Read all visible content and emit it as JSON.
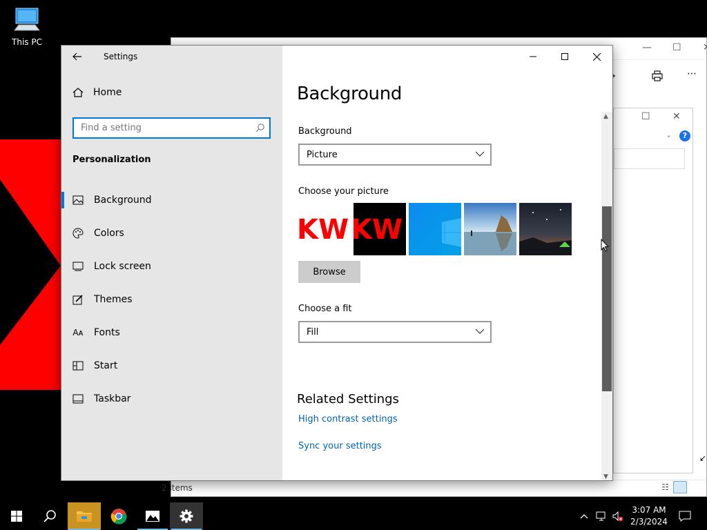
{
  "desktop": {
    "icon_label": "This PC"
  },
  "explorer": {
    "status_text": "2 items"
  },
  "settings": {
    "window_title": "Settings",
    "home_label": "Home",
    "search_placeholder": "Find a setting",
    "section_title": "Personalization",
    "nav_items": [
      {
        "label": "Background",
        "icon": "image-icon",
        "active": true
      },
      {
        "label": "Colors",
        "icon": "palette-icon",
        "active": false
      },
      {
        "label": "Lock screen",
        "icon": "lock-screen-icon",
        "active": false
      },
      {
        "label": "Themes",
        "icon": "themes-brush-icon",
        "active": false
      },
      {
        "label": "Fonts",
        "icon": "fonts-icon",
        "active": false
      },
      {
        "label": "Start",
        "icon": "start-grid-icon",
        "active": false
      },
      {
        "label": "Taskbar",
        "icon": "taskbar-icon",
        "active": false
      }
    ],
    "page_title": "Background",
    "background_label": "Background",
    "background_value": "Picture",
    "choose_picture_label": "Choose your picture",
    "thumbnails": [
      "kw-red-on-white",
      "kw-red-on-black",
      "windows-blue",
      "beach-rocks",
      "night-sky-tent"
    ],
    "browse_label": "Browse",
    "fit_label": "Choose a fit",
    "fit_value": "Fill",
    "related_title": "Related Settings",
    "links": [
      "High contrast settings",
      "Sync your settings"
    ]
  },
  "taskbar": {
    "apps": [
      "start-icon",
      "search-icon",
      "file-explorer-icon",
      "chrome-icon",
      "photos-icon",
      "settings-gear-icon"
    ],
    "time": "3:07 AM",
    "date": "2/3/2024"
  },
  "colors": {
    "accent": "#0078d7",
    "link": "#0063b1",
    "wallpaper_red": "#ff0000",
    "nav_bg": "#e6e6e6"
  }
}
